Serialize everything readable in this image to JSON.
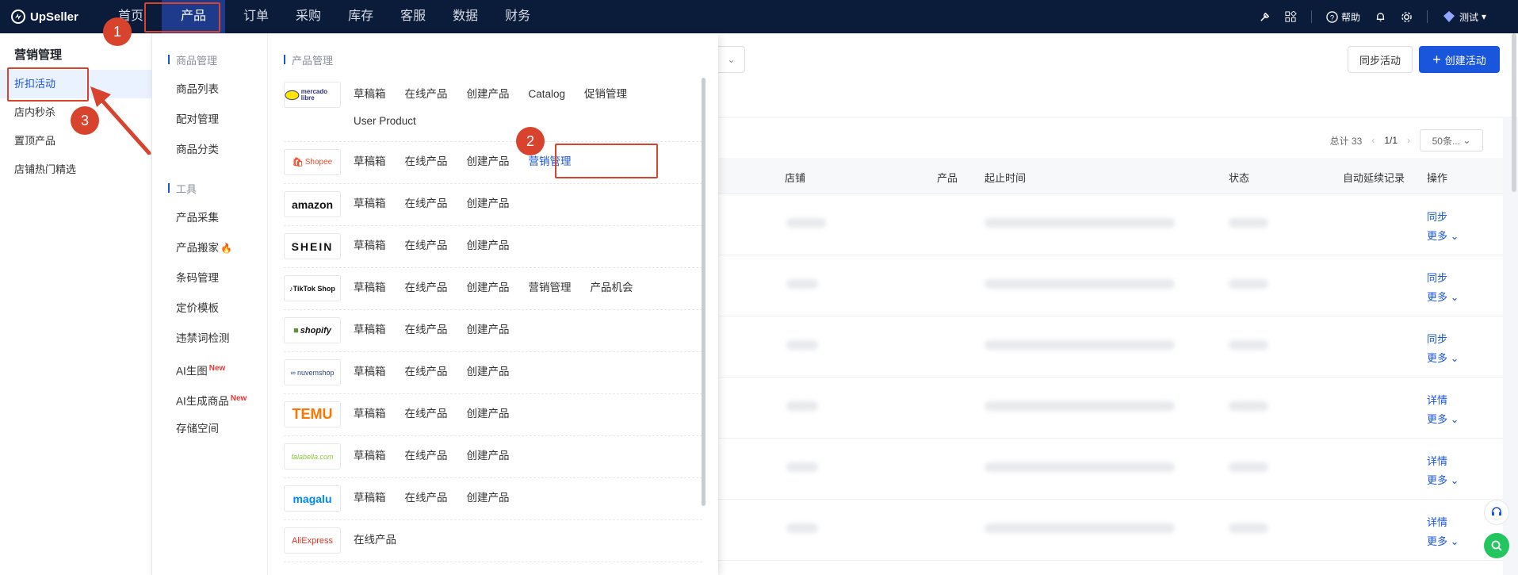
{
  "app": {
    "name": "UpSeller"
  },
  "nav": {
    "items": [
      "首页",
      "产品",
      "订单",
      "采购",
      "库存",
      "客服",
      "数据",
      "财务"
    ],
    "active_index": 1
  },
  "topbar_right": {
    "help_label": "帮助",
    "user_label": "测试"
  },
  "sidebar": {
    "title": "营销管理",
    "items": [
      "折扣活动",
      "店内秒杀",
      "置顶产品",
      "店铺热门精选"
    ],
    "active_index": 0
  },
  "mega_menu": {
    "groups": [
      {
        "title": "商品管理",
        "links": [
          "商品列表",
          "配对管理",
          "商品分类"
        ]
      },
      {
        "title": "工具",
        "links": [
          "产品采集",
          "产品搬家",
          "条码管理",
          "定价模板",
          "违禁词检测",
          "AI生图",
          "AI生成商品",
          "存储空间"
        ]
      }
    ],
    "new_badge": "New",
    "right_title": "产品管理",
    "platforms": [
      {
        "brand": "mercado libre",
        "links": [
          "草稿箱",
          "在线产品",
          "创建产品",
          "Catalog",
          "促销管理",
          "User Product"
        ]
      },
      {
        "brand": "Shopee",
        "links": [
          "草稿箱",
          "在线产品",
          "创建产品",
          "营销管理"
        ]
      },
      {
        "brand": "amazon",
        "links": [
          "草稿箱",
          "在线产品",
          "创建产品"
        ]
      },
      {
        "brand": "SHEIN",
        "links": [
          "草稿箱",
          "在线产品",
          "创建产品"
        ]
      },
      {
        "brand": "TikTok Shop",
        "links": [
          "草稿箱",
          "在线产品",
          "创建产品",
          "营销管理",
          "产品机会"
        ]
      },
      {
        "brand": "shopify",
        "links": [
          "草稿箱",
          "在线产品",
          "创建产品"
        ]
      },
      {
        "brand": "nuvemshop",
        "links": [
          "草稿箱",
          "在线产品",
          "创建产品"
        ]
      },
      {
        "brand": "TEMU",
        "links": [
          "草稿箱",
          "在线产品",
          "创建产品"
        ]
      },
      {
        "brand": "falabella.com",
        "links": [
          "草稿箱",
          "在线产品",
          "创建产品"
        ]
      },
      {
        "brand": "magalu",
        "links": [
          "草稿箱",
          "在线产品",
          "创建产品"
        ]
      },
      {
        "brand": "AliExpress",
        "links": [
          "在线产品"
        ]
      }
    ]
  },
  "page": {
    "sync_button": "同步活动",
    "create_button": "创建活动",
    "total": "总计 33",
    "page_indicator": "1/1",
    "page_size": "50条...",
    "columns": [
      "店铺",
      "产品",
      "起止时间",
      "状态",
      "自动延续记录",
      "操作"
    ],
    "rows": [
      {
        "op": "同步",
        "more": "更多"
      },
      {
        "op": "同步",
        "more": "更多"
      },
      {
        "op": "同步",
        "more": "更多"
      },
      {
        "op": "详情",
        "more": "更多"
      },
      {
        "op": "详情",
        "more": "更多"
      },
      {
        "op": "详情",
        "more": "更多"
      }
    ]
  },
  "annotations": [
    "1",
    "2",
    "3"
  ],
  "colors": {
    "accent": "#1a56db",
    "topbar": "#0b1b3a",
    "annotation": "#d8432e"
  }
}
